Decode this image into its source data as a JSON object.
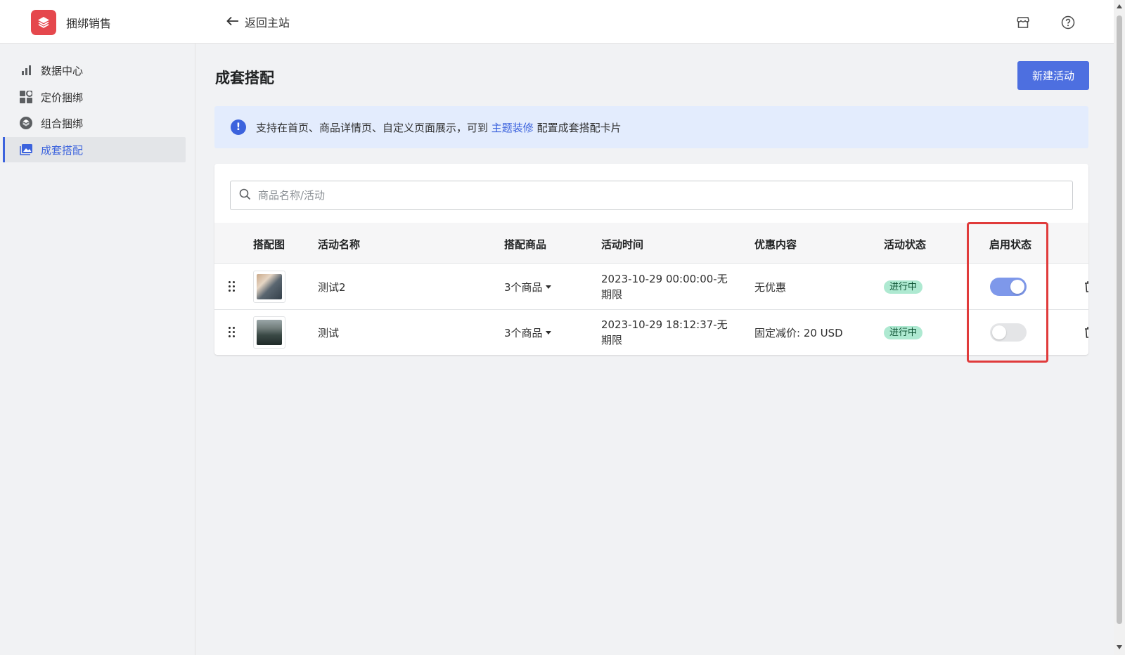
{
  "app": {
    "name": "捆绑销售",
    "back_label": "返回主站"
  },
  "sidebar": {
    "items": [
      {
        "label": "数据中心",
        "icon": "bar-chart-icon",
        "active": false
      },
      {
        "label": "定价捆绑",
        "icon": "grid-icon",
        "active": false
      },
      {
        "label": "组合捆绑",
        "icon": "box-icon",
        "active": false
      },
      {
        "label": "成套搭配",
        "icon": "image-icon",
        "active": true
      }
    ]
  },
  "page": {
    "title": "成套搭配",
    "new_button": "新建活动"
  },
  "banner": {
    "text_before": "支持在首页、商品详情页、自定义页面展示，可到",
    "link": "主题装修",
    "text_after": "配置成套搭配卡片"
  },
  "search": {
    "placeholder": "商品名称/活动",
    "value": ""
  },
  "table": {
    "headers": {
      "image": "搭配图",
      "name": "活动名称",
      "products": "搭配商品",
      "time": "活动时间",
      "discount": "优惠内容",
      "status": "活动状态",
      "enabled": "启用状态"
    },
    "rows": [
      {
        "name": "测试2",
        "products": "3个商品",
        "time": "2023-10-29 00:00:00-无期限",
        "discount": "无优惠",
        "status": "进行中",
        "enabled": true
      },
      {
        "name": "测试",
        "products": "3个商品",
        "time": "2023-10-29 18:12:37-无期限",
        "discount": "固定减价: 20 USD",
        "status": "进行中",
        "enabled": false
      }
    ]
  },
  "colors": {
    "accent": "#4d6fe0",
    "logo": "#e5484d",
    "highlight": "#e03b3b",
    "badge_bg": "#aee9d1"
  }
}
